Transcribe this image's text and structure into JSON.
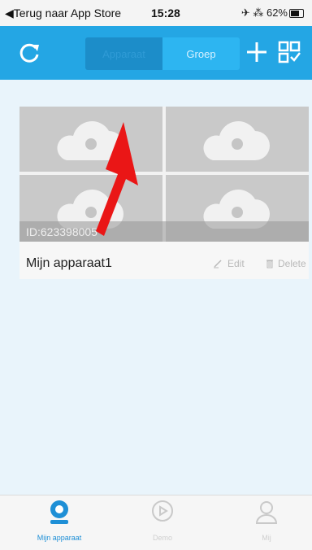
{
  "status_bar": {
    "back_text": "◀Terug naar App Store",
    "time": "15:28",
    "right_text": "✈ ⁂ 62%"
  },
  "header": {
    "segments": [
      {
        "label": "Apparaat",
        "active": true
      },
      {
        "label": "Groep",
        "active": false
      }
    ],
    "colors": {
      "bar": "#24a6e4",
      "active_tab": "#1c8dc9",
      "inactive_tab": "#2db5f1"
    }
  },
  "device": {
    "id_text": "ID:623398005",
    "name": "Mijn apparaat1",
    "edit_label": "Edit",
    "delete_label": "Delete"
  },
  "tabbar": {
    "items": [
      {
        "label": "Mijn apparaat",
        "icon": "camera-icon",
        "active": true
      },
      {
        "label": "Demo",
        "icon": "play-icon",
        "active": false
      },
      {
        "label": "Mij",
        "icon": "user-icon",
        "active": false
      }
    ]
  }
}
